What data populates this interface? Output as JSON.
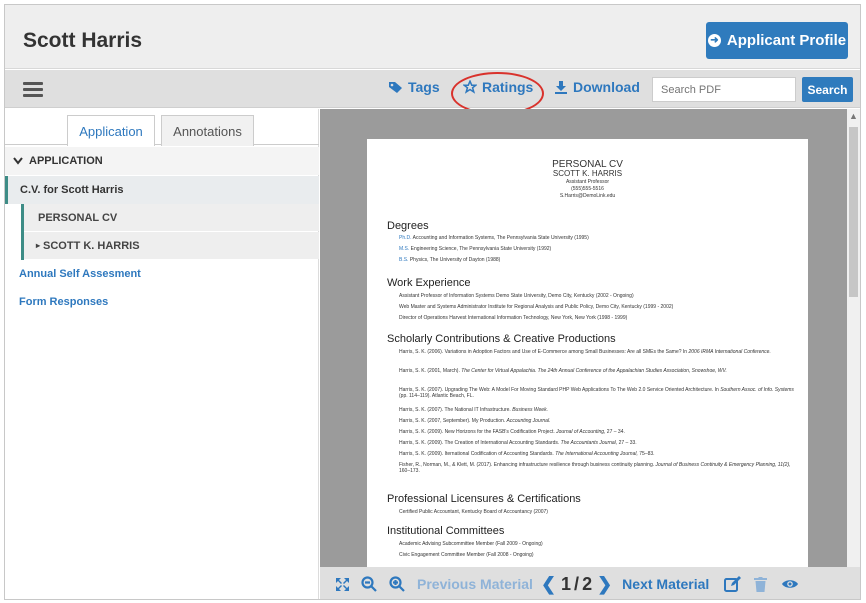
{
  "header": {
    "title": "Scott Harris",
    "profile_button": "Applicant Profile"
  },
  "toolbar": {
    "tags": "Tags",
    "ratings": "Ratings",
    "download": "Download",
    "search_placeholder": "Search PDF",
    "search_button": "Search"
  },
  "sidebar": {
    "tabs": [
      {
        "label": "Application",
        "active": true
      },
      {
        "label": "Annotations",
        "active": false
      }
    ],
    "section": "APPLICATION",
    "cv_item": "C.V. for Scott Harris",
    "cv_children": [
      "PERSONAL CV",
      "SCOTT K. HARRIS"
    ],
    "links": [
      "Annual Self Assesment",
      "Form Responses"
    ]
  },
  "pdf": {
    "title": "PERSONAL CV",
    "name": "SCOTT K. HARRIS",
    "role": "Assistant Professor",
    "phone": "(555)555-5516",
    "email": "S.Harris@DemoLink.edu",
    "degrees_heading": "Degrees",
    "degrees": [
      {
        "key": "Ph.D.",
        "text": " Accounting and Information Systems, The Pennsylvania State University (1995)"
      },
      {
        "key": "M.S.",
        "text": " Engineering Science, The Pennsylvania State University (1992)"
      },
      {
        "key": "B.S.",
        "text": " Physics, The University of Dayton (1988)"
      }
    ],
    "work_heading": "Work Experience",
    "work": [
      "Assistant Professor of Information Systems Demo State University, Demo City, Kentucky (2002 - Ongoing)",
      "Web Master and Systems Administrator Institute for Regional Analysis and Public Policy, Demo City, Kentucky (1999 - 2002)",
      "Director of Operations Harvest International Information Technology, New York, New York (1998 - 1999)"
    ],
    "scholarly_heading": "Scholarly Contributions & Creative Productions",
    "scholarly": [
      {
        "plain": "Harris, S. K. (2006). Variations in Adoption Factors and Use of E-Commerce among Small Businesses: Are all SMEs the Same? In ",
        "italic": "2006 IRMA International Conference."
      },
      {
        "plain": "Harris, S. K. (2001, March). ",
        "italic": "The Center for Virtual Appalachia. The 24th Annual Conference of the Appalachian Studies Association, Snowshoe, WV."
      },
      {
        "plain": "Harris, S. K. (2007). Upgrading The Web: A Model For Moving Standard PHP Web Applications To The Web 2.0 Service Oriented Architecture. In ",
        "italic": "Southern Assoc. of Info. Systems",
        "tail": " (pp. 114–119). Atlantic Beach, FL."
      },
      {
        "plain": "Harris, S. K. (2007). The National IT Infrastructure. ",
        "italic": "Business Week."
      },
      {
        "plain": "Harris, S. K. (2007, September). My Production. ",
        "italic": "Accounting Journal."
      },
      {
        "plain": "Harris, S. K. (2009). New Horizons for the FASB's Codification Project. ",
        "italic": "Journal of Accounting,",
        "tail": " 27 – 34."
      },
      {
        "plain": "Harris, S. K. (2009). The Creation of International Accounting Standards. ",
        "italic": "The Accountants Journal,",
        "tail": " 27 – 33."
      },
      {
        "plain": "Harris, S. K. (2009). Iternational Codification of Accounting Standards. ",
        "italic": "The International Accounting Journal,",
        "tail": " 75–83."
      },
      {
        "plain": "Fisher, R., Norman, M., & Klett, M. (2017). Enhancing infrastructure resilience through business continuity planning. ",
        "italic": "Journal of Business Continuity & Emergency Planning, 11(2),",
        "tail": " 160–173."
      }
    ],
    "licensure_heading": "Professional Licensures & Certifications",
    "licensure": [
      "Certified Public Accountant, Kentucky Board of Accountancy (2007)"
    ],
    "committees_heading": "Institutional Committees",
    "committees": [
      "Academic Advising Subcommittee Member (Fall 2009 - Ongoing)",
      "Civic Engagement Committee Member (Fall 2008 - Ongoing)"
    ]
  },
  "bottom": {
    "previous": "Previous Material",
    "page_current": "1",
    "page_sep": "/",
    "page_total": "2",
    "next": "Next Material"
  },
  "colors": {
    "accent": "#2f7bbd",
    "highlight_ring": "#d9322c",
    "teal": "#3d8c86"
  },
  "icons": [
    "menu-icon",
    "tag-icon",
    "star-icon",
    "download-icon",
    "expand-icon",
    "zoom-out-icon",
    "zoom-in-icon",
    "chevron-left-icon",
    "chevron-right-icon",
    "edit-icon",
    "trash-icon",
    "eye-icon",
    "chevron-down-icon",
    "caret-right-icon"
  ]
}
